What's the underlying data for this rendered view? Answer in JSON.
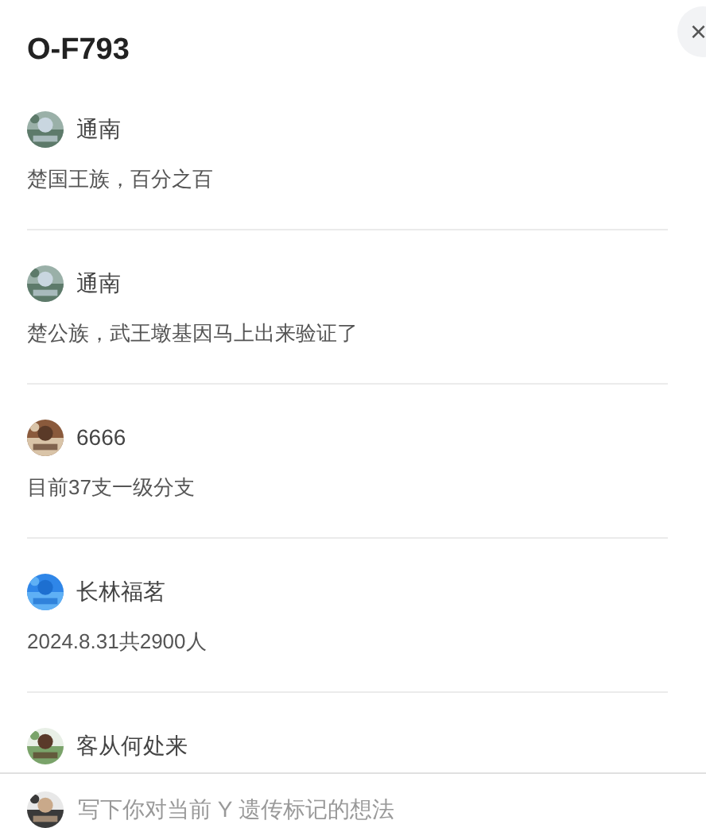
{
  "title": "O-F793",
  "close": "×",
  "comments": [
    {
      "user": "通南",
      "text": "楚国王族，百分之百"
    },
    {
      "user": "通南",
      "text": "楚公族，武王墩基因马上出来验证了"
    },
    {
      "user": "6666",
      "text": "目前37支一级分支"
    },
    {
      "user": "长林福茗",
      "text": "2024.8.31共2900人"
    },
    {
      "user": "客从何处来"
    }
  ],
  "comment_box": {
    "placeholder": "写下你对当前 Y 遗传标记的想法"
  }
}
